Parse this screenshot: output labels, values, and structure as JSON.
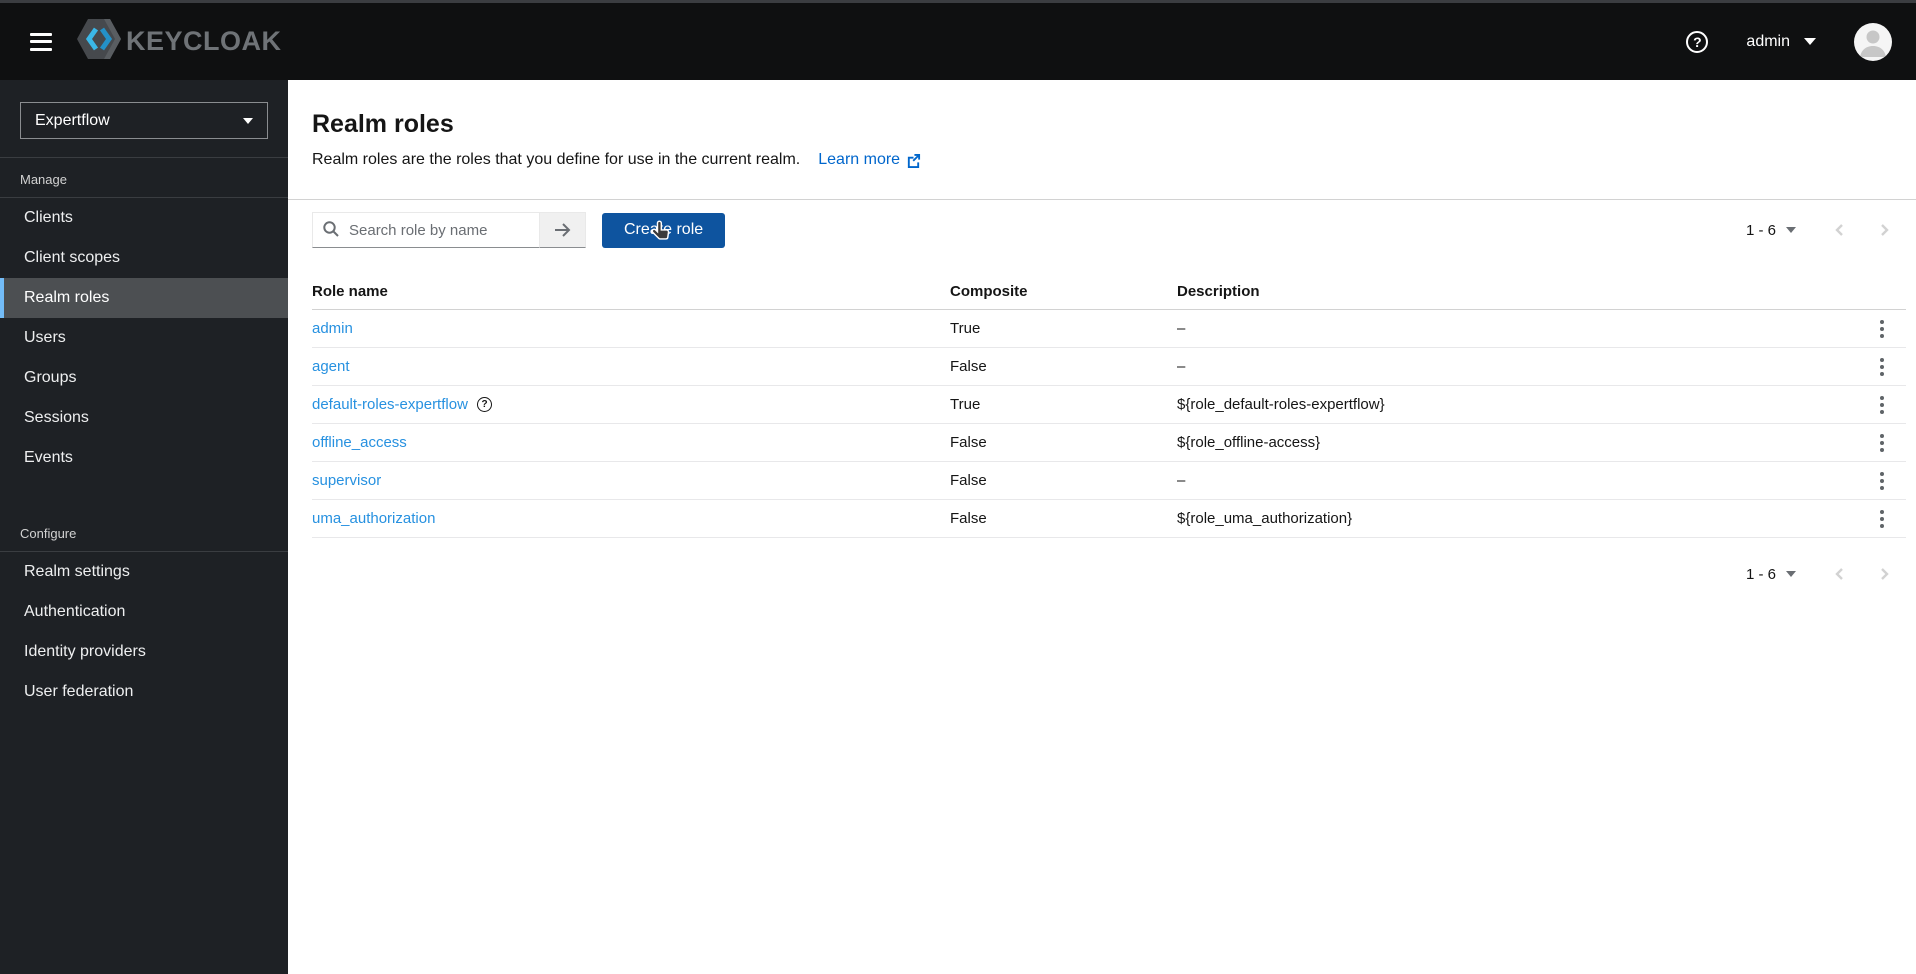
{
  "topbar": {
    "brand": "KEYCLOAK",
    "username": "admin",
    "icons": [
      "hamburger-icon",
      "keycloak-logo-icon",
      "help-circle-icon",
      "user-caret-icon",
      "avatar"
    ]
  },
  "sidebar": {
    "realm_selector": {
      "value": "Expertflow"
    },
    "sections": [
      {
        "label": "Manage",
        "active": "Realm roles",
        "items": [
          "Clients",
          "Client scopes",
          "Realm roles",
          "Users",
          "Groups",
          "Sessions",
          "Events"
        ]
      },
      {
        "label": "Configure",
        "active": "",
        "items": [
          "Realm settings",
          "Authentication",
          "Identity providers",
          "User federation"
        ]
      }
    ]
  },
  "page": {
    "title": "Realm roles",
    "subtitle": "Realm roles are the roles that you define for use in the current realm.",
    "learn_more_label": "Learn more"
  },
  "toolbar": {
    "search_placeholder": "Search role by name",
    "create_button_label": "Create role",
    "pagination": {
      "range": "1 - 6"
    }
  },
  "table": {
    "columns": [
      "Role name",
      "Composite",
      "Description"
    ],
    "rows": [
      {
        "name": "admin",
        "composite": "True",
        "description": "–",
        "help": false
      },
      {
        "name": "agent",
        "composite": "False",
        "description": "–",
        "help": false
      },
      {
        "name": "default-roles-expertflow",
        "composite": "True",
        "description": "${role_default-roles-expertflow}",
        "help": true
      },
      {
        "name": "offline_access",
        "composite": "False",
        "description": "${role_offline-access}",
        "help": false
      },
      {
        "name": "supervisor",
        "composite": "False",
        "description": "–",
        "help": false
      },
      {
        "name": "uma_authorization",
        "composite": "False",
        "description": "${role_uma_authorization}",
        "help": false
      }
    ]
  },
  "colors": {
    "accent": "#0066cc",
    "primary_button": "#0e549f",
    "active_nav_border": "#73bcf7",
    "table_link": "#2791e0",
    "topbar_bg": "#0f1011",
    "sidebar_bg": "#1e2125"
  }
}
